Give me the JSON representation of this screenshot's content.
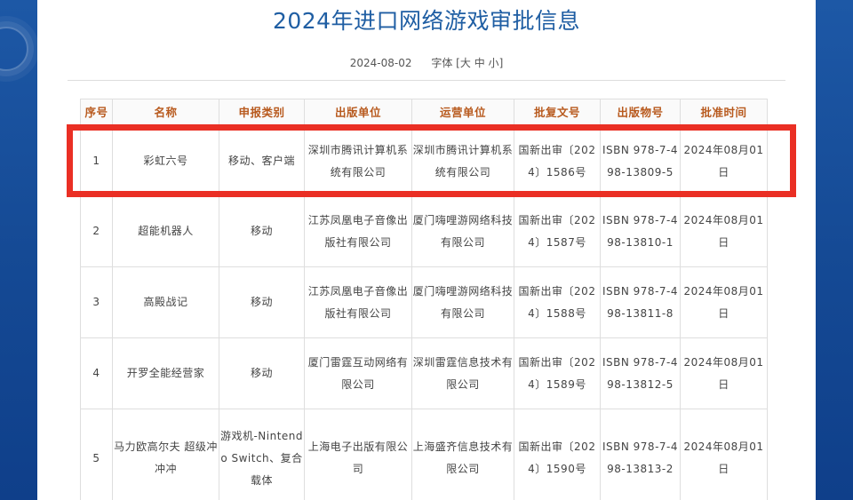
{
  "article": {
    "title": "2024年进口网络游戏审批信息",
    "date": "2024-08-02",
    "font_size_label": "字体",
    "font_size_open": "[",
    "font_size_large": "大",
    "font_size_medium": "中",
    "font_size_small": "小",
    "font_size_close": "]"
  },
  "table": {
    "headers": [
      "序号",
      "名称",
      "申报类别",
      "出版单位",
      "运营单位",
      "批复文号",
      "出版物号",
      "批准时间"
    ],
    "rows": [
      [
        "1",
        "彩虹六号",
        "移动、客户端",
        "深圳市腾讯计算机系统有限公司",
        "深圳市腾讯计算机系统有限公司",
        "国新出审〔2024〕1586号",
        "ISBN 978-7-498-13809-5",
        "2024年08月01日"
      ],
      [
        "2",
        "超能机器人",
        "移动",
        "江苏凤凰电子音像出版社有限公司",
        "厦门嗨哩游网络科技有限公司",
        "国新出审〔2024〕1587号",
        "ISBN 978-7-498-13810-1",
        "2024年08月01日"
      ],
      [
        "3",
        "高殿战记",
        "移动",
        "江苏凤凰电子音像出版社有限公司",
        "厦门嗨哩游网络科技有限公司",
        "国新出审〔2024〕1588号",
        "ISBN 978-7-498-13811-8",
        "2024年08月01日"
      ],
      [
        "4",
        "开罗全能经营家",
        "移动",
        "厦门雷霆互动网络有限公司",
        "深圳雷霆信息技术有限公司",
        "国新出审〔2024〕1589号",
        "ISBN 978-7-498-13812-5",
        "2024年08月01日"
      ],
      [
        "5",
        "马力欧高尔夫 超级冲冲冲",
        "游戏机-Nintendo Switch、复合载体",
        "上海电子出版有限公司",
        "上海盛齐信息技术有限公司",
        "国新出审〔2024〕1590号",
        "ISBN 978-7-498-13813-2",
        "2024年08月01日"
      ]
    ]
  },
  "colors": {
    "title": "#1f5ea3",
    "header_text": "#b85a1e",
    "highlight_box": "#ea2f24",
    "side_bg": "#154a95"
  }
}
